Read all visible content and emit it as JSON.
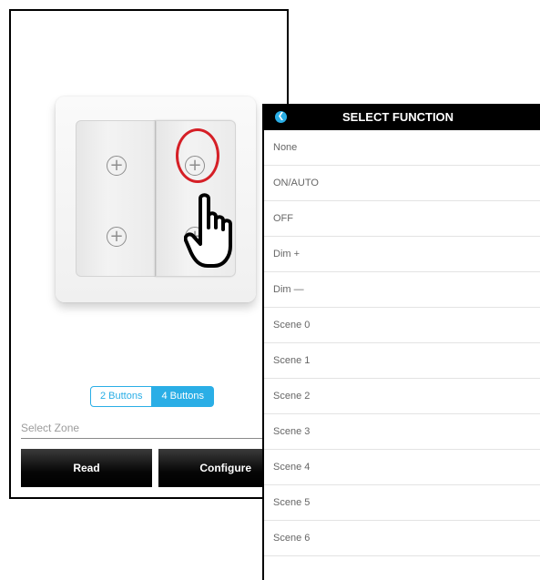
{
  "switch": {
    "icons": [
      "plus-circle-icon",
      "plus-circle-icon",
      "plus-circle-icon",
      "plus-circle-icon"
    ],
    "highlight_color": "#d51f26",
    "hand": "pointing-hand-icon"
  },
  "buttons_toggle": {
    "options": [
      "2 Buttons",
      "4 Buttons"
    ],
    "selected": "4 Buttons"
  },
  "zone": {
    "placeholder": "Select Zone",
    "value": ""
  },
  "actions": {
    "read_label": "Read",
    "configure_label": "Configure"
  },
  "function_panel": {
    "title": "SELECT FUNCTION",
    "back_icon": "back-arrow-icon",
    "items": [
      "None",
      "ON/AUTO",
      "OFF",
      "Dim +",
      "Dim —",
      "Scene 0",
      "Scene 1",
      "Scene 2",
      "Scene 3",
      "Scene 4",
      "Scene 5",
      "Scene 6"
    ]
  },
  "colors": {
    "accent": "#2aaee6",
    "header_bg": "#000000",
    "button_bg": "#000000"
  }
}
